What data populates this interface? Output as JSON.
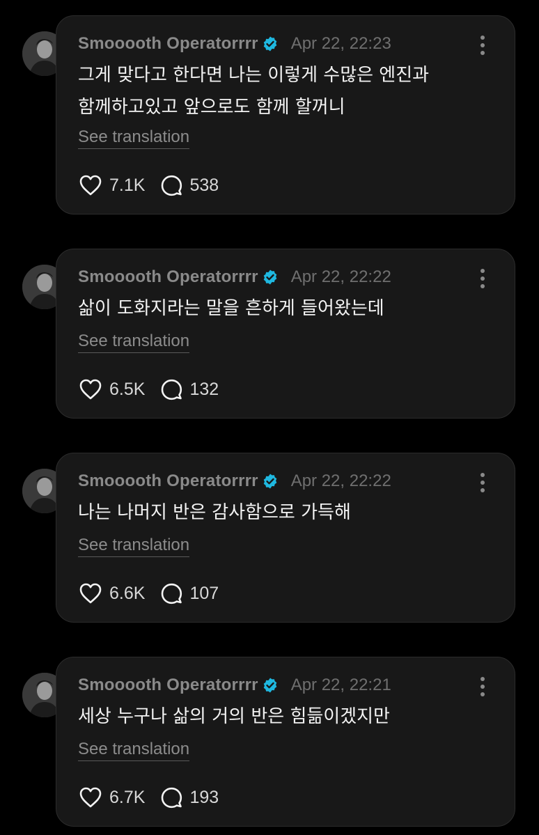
{
  "posts": [
    {
      "username": "Smooooth Operatorrrr",
      "timestamp": "Apr 22, 22:23",
      "lines": [
        "그게 맞다고 한다면 나는 이렇게 수많은 엔진과",
        "함께하고있고 앞으로도 함께 할꺼니"
      ],
      "translate_label": "See translation",
      "likes": "7.1K",
      "replies": "538"
    },
    {
      "username": "Smooooth Operatorrrr",
      "timestamp": "Apr 22, 22:22",
      "lines": [
        "삶이 도화지라는 말을 흔하게 들어왔는데"
      ],
      "translate_label": "See translation",
      "likes": "6.5K",
      "replies": "132"
    },
    {
      "username": "Smooooth Operatorrrr",
      "timestamp": "Apr 22, 22:22",
      "lines": [
        "나는 나머지 반은 감사함으로 가득해"
      ],
      "translate_label": "See translation",
      "likes": "6.6K",
      "replies": "107"
    },
    {
      "username": "Smooooth Operatorrrr",
      "timestamp": "Apr 22, 22:21",
      "lines": [
        "세상 누구나 삶의 거의 반은 힘듦이겠지만"
      ],
      "translate_label": "See translation",
      "likes": "6.7K",
      "replies": "193"
    }
  ],
  "icons": {
    "verified": "verified-badge-icon",
    "like": "heart-icon",
    "reply": "speech-bubble-icon",
    "more": "more-vertical-icon"
  },
  "colors": {
    "background": "#000000",
    "card": "#181818",
    "verified": "#1fb8e0",
    "username": "#8a8a8a",
    "text": "#f3f3f3"
  }
}
